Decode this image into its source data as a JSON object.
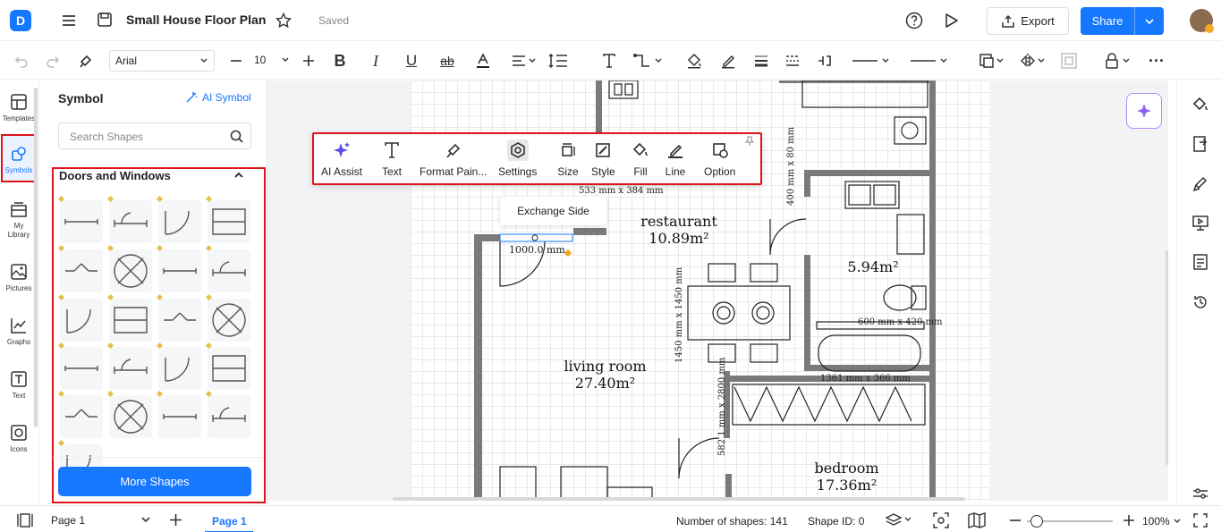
{
  "app": {
    "logo_letter": "D",
    "title": "Small House Floor Plan",
    "save_status": "Saved",
    "export_label": "Export",
    "share_label": "Share",
    "accent": "#1677ff",
    "highlight": "#e0131a"
  },
  "toolbar": {
    "font_family": "Arial",
    "font_size": "10",
    "icons": [
      "undo-icon",
      "redo-icon",
      "format-painter-icon",
      "decrease-size-icon",
      "increase-size-icon",
      "bold-icon",
      "italic-icon",
      "underline-icon",
      "strikethrough-icon",
      "font-color-icon",
      "align-icon",
      "line-spacing-icon",
      "text-icon",
      "connector-icon",
      "fill-icon",
      "line-color-icon",
      "line-weight-icon",
      "dash-icon",
      "arrange-icon",
      "line-style-icon",
      "arrow-style-icon",
      "shape-icon",
      "flip-icon",
      "group-icon",
      "lock-icon",
      "more-icon"
    ]
  },
  "rail": {
    "items": [
      {
        "label": "Templates",
        "icon": "templates-icon"
      },
      {
        "label": "Symbols",
        "icon": "symbols-icon"
      },
      {
        "label": "My Library",
        "icon": "library-icon"
      },
      {
        "label": "Pictures",
        "icon": "pictures-icon"
      },
      {
        "label": "Graphs",
        "icon": "graphs-icon"
      },
      {
        "label": "Text",
        "icon": "text-icon"
      },
      {
        "label": "Icons",
        "icon": "icons-icon"
      }
    ]
  },
  "panel": {
    "title": "Symbol",
    "ai_symbol": "AI Symbol",
    "search_placeholder": "Search Shapes",
    "category": "Doors and Windows",
    "more_shapes": "More Shapes"
  },
  "float_bar": {
    "items": [
      {
        "label": "AI Assist",
        "icon": "ai-assist-icon"
      },
      {
        "label": "Text",
        "icon": "text-icon"
      },
      {
        "label": "Format Pain...",
        "icon": "format-painter-icon"
      },
      {
        "label": "Settings",
        "icon": "settings-icon"
      },
      {
        "label": "Size",
        "icon": "size-icon"
      },
      {
        "label": "Style",
        "icon": "style-icon"
      },
      {
        "label": "Fill",
        "icon": "fill-icon"
      },
      {
        "label": "Line",
        "icon": "line-icon"
      },
      {
        "label": "Option",
        "icon": "option-icon"
      }
    ],
    "exchange_side": "Exchange Side"
  },
  "floorplan": {
    "rooms": [
      {
        "name": "restaurant",
        "area": "10.89m²"
      },
      {
        "name": "living room",
        "area": "27.40m²"
      },
      {
        "name": "bedroom",
        "area": "17.36m²"
      },
      {
        "name": "",
        "area": "5.94m²"
      }
    ],
    "dims": {
      "door": "1000.0 mm",
      "top_partial": "533 mm x 384 mm",
      "vertical_1": "400 mm x 80 mm",
      "table": "1450 mm x 1450 mm",
      "sink": "600 mm x 420 mm",
      "bed_top": "1361 mm x 366 mm",
      "bed_left": "582 1 mm x 2800 mm"
    }
  },
  "status": {
    "page_select": "Page 1",
    "page_tab": "Page 1",
    "shapes": "Number of shapes: 141",
    "shape_id": "Shape ID: 0",
    "zoom": "100%"
  }
}
